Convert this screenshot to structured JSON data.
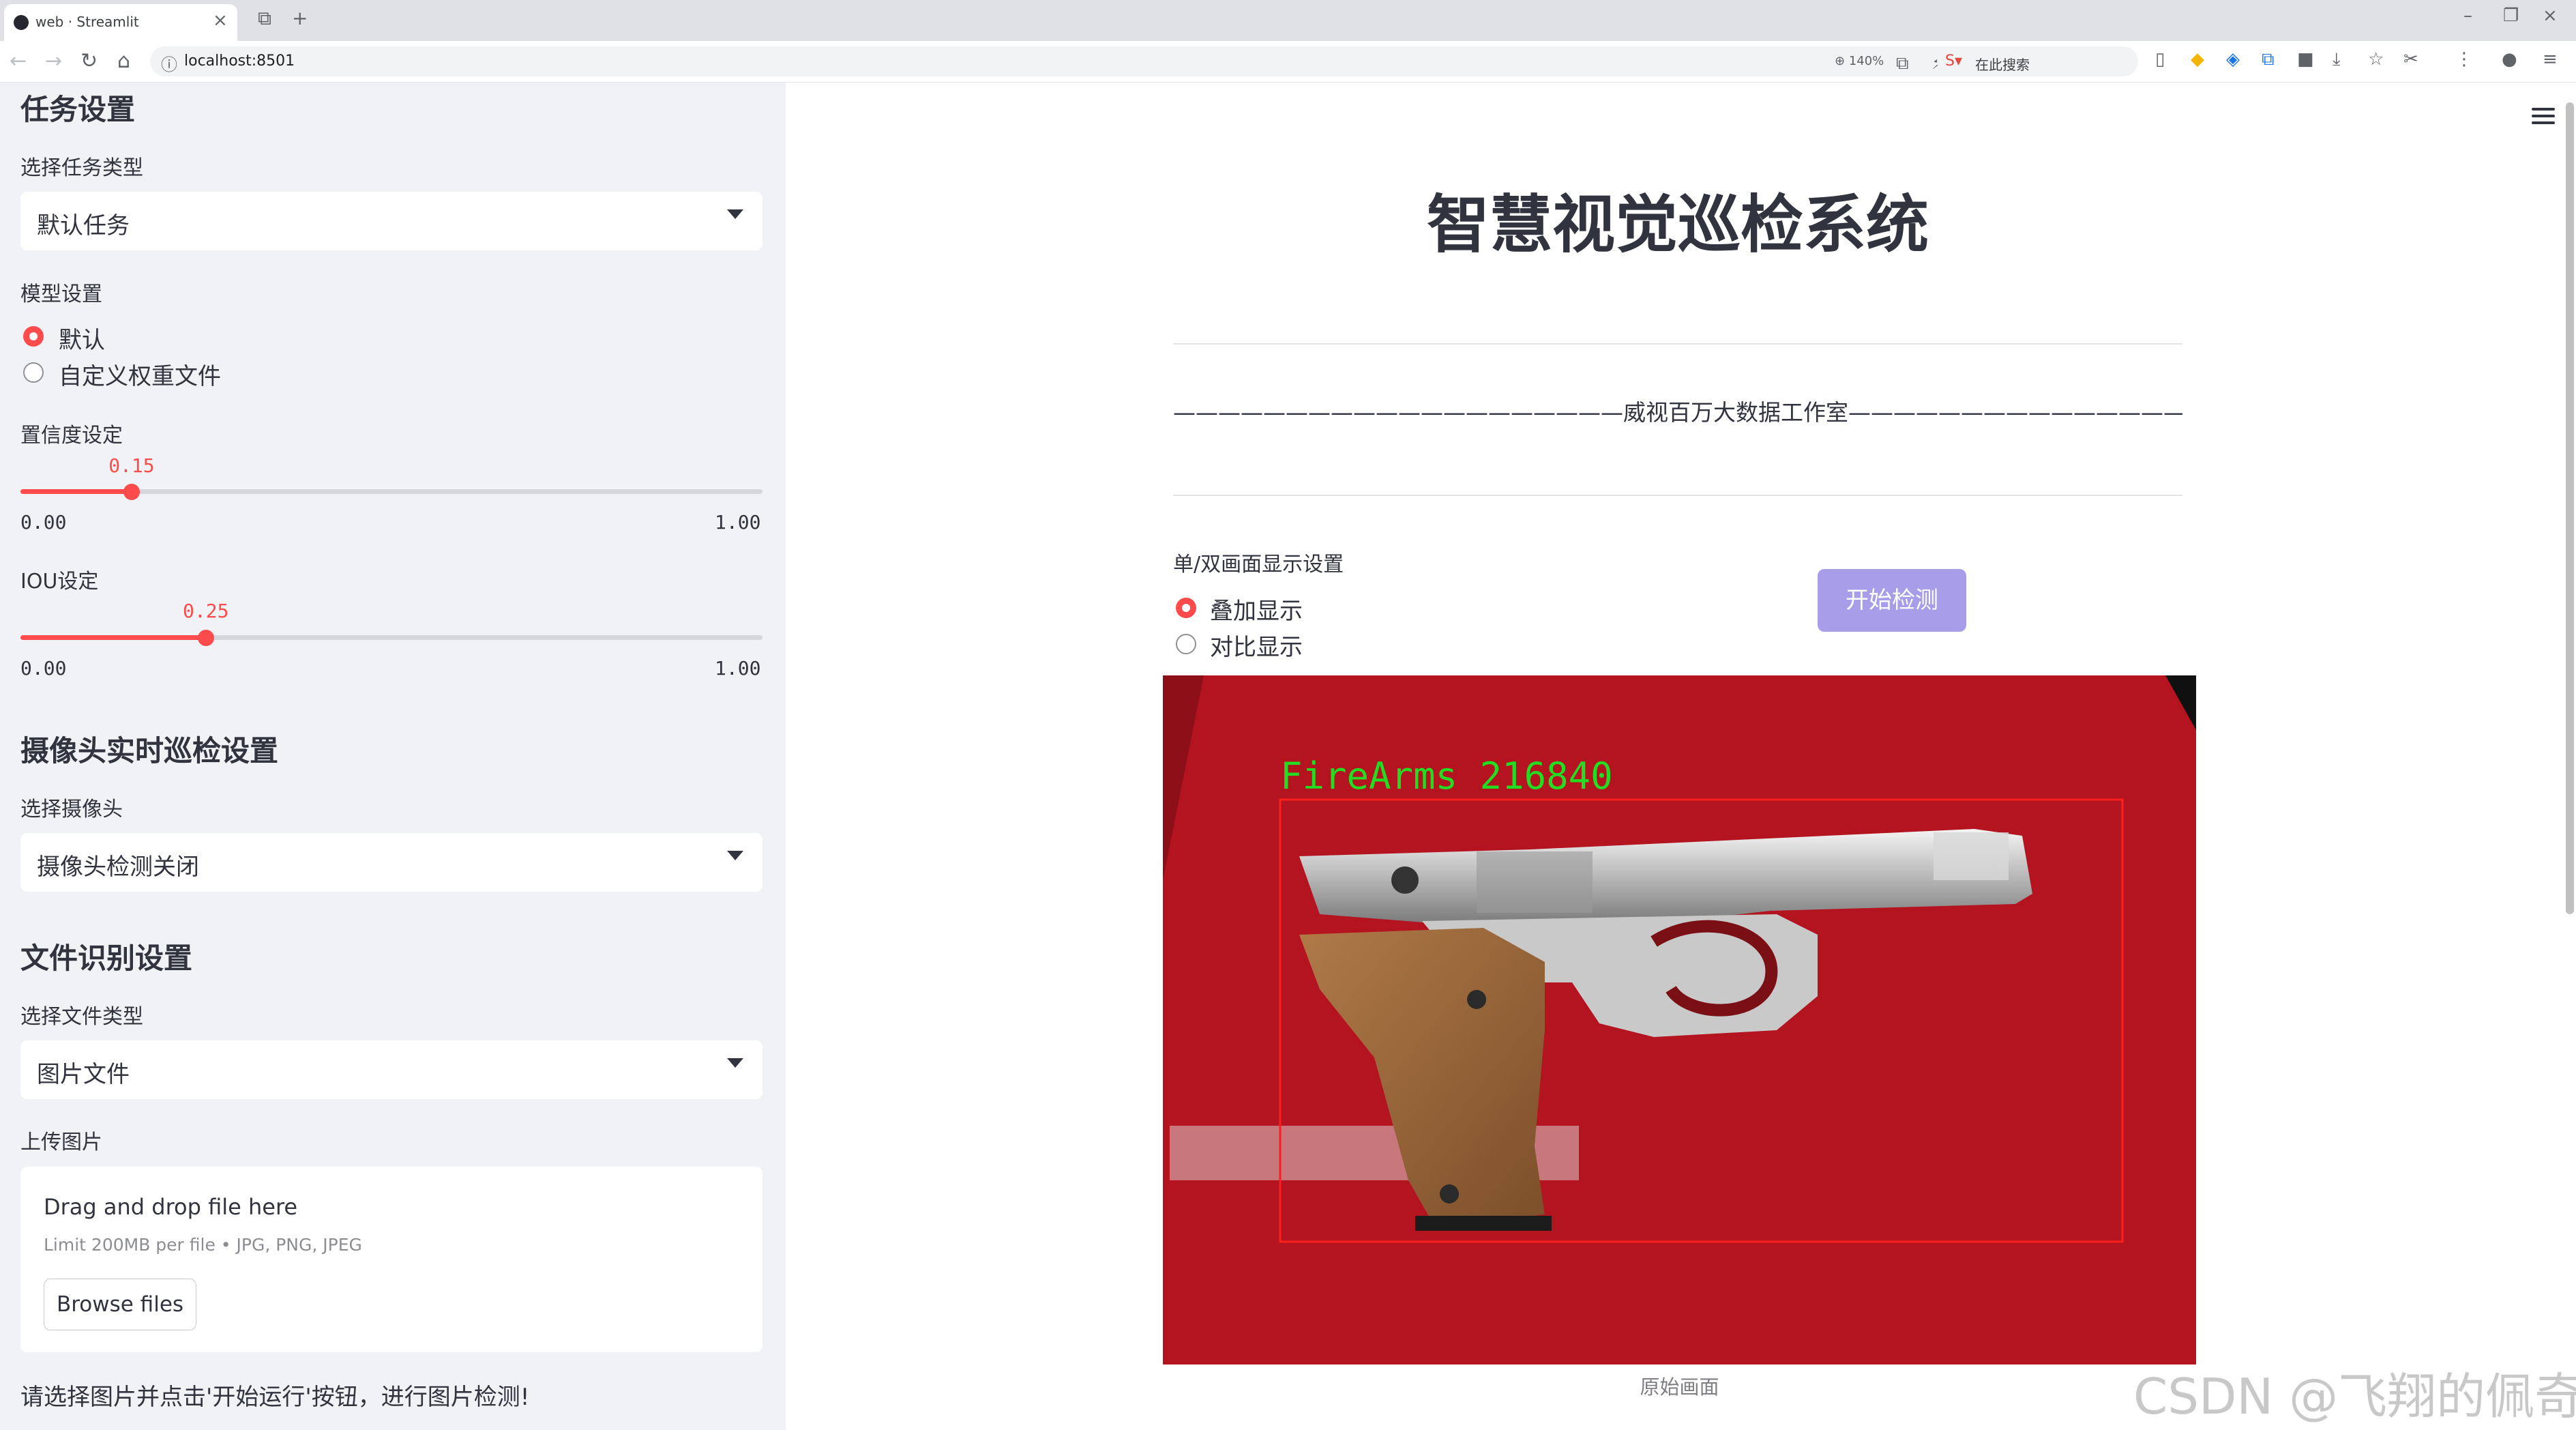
{
  "browser": {
    "tab_title": "web · Streamlit",
    "url": "localhost:8501",
    "zoom": "140%",
    "search_placeholder": "在此搜索"
  },
  "sidebar": {
    "task_heading": "任务设置",
    "task_type_label": "选择任务类型",
    "task_type_value": "默认任务",
    "model_label": "模型设置",
    "model_options": [
      "默认",
      "自定义权重文件"
    ],
    "model_selected": 0,
    "conf_label": "置信度设定",
    "conf_value": 0.15,
    "conf_min": "0.00",
    "conf_max": "1.00",
    "iou_label": "IOU设定",
    "iou_value": 0.25,
    "iou_min": "0.00",
    "iou_max": "1.00",
    "camera_heading": "摄像头实时巡检设置",
    "camera_label": "选择摄像头",
    "camera_value": "摄像头检测关闭",
    "file_heading": "文件识别设置",
    "file_type_label": "选择文件类型",
    "file_type_value": "图片文件",
    "upload_label": "上传图片",
    "upload_title": "Drag and drop file here",
    "upload_limit": "Limit 200MB per file • JPG, PNG, JPEG",
    "browse_label": "Browse files",
    "info_text": "请选择图片并点击'开始运行'按钮，进行图片检测!"
  },
  "main": {
    "title": "智慧视觉巡检系统",
    "subtitle": "————————————————————威视百万大数据工作室—————————————————————",
    "display_label": "单/双画面显示设置",
    "display_options": [
      "叠加显示",
      "对比显示"
    ],
    "display_selected": 0,
    "start_button": "开始检测",
    "detection_label": "FireArms  216840",
    "image_caption": "原始画面",
    "watermark": "CSDN @飞翔的佩奇"
  },
  "colors": {
    "accent": "#ff4b4b",
    "sidebar_bg": "#f0f2f6",
    "button": "#a79de8",
    "detection_text": "#22dd22",
    "detection_box": "#ff1e1e"
  }
}
